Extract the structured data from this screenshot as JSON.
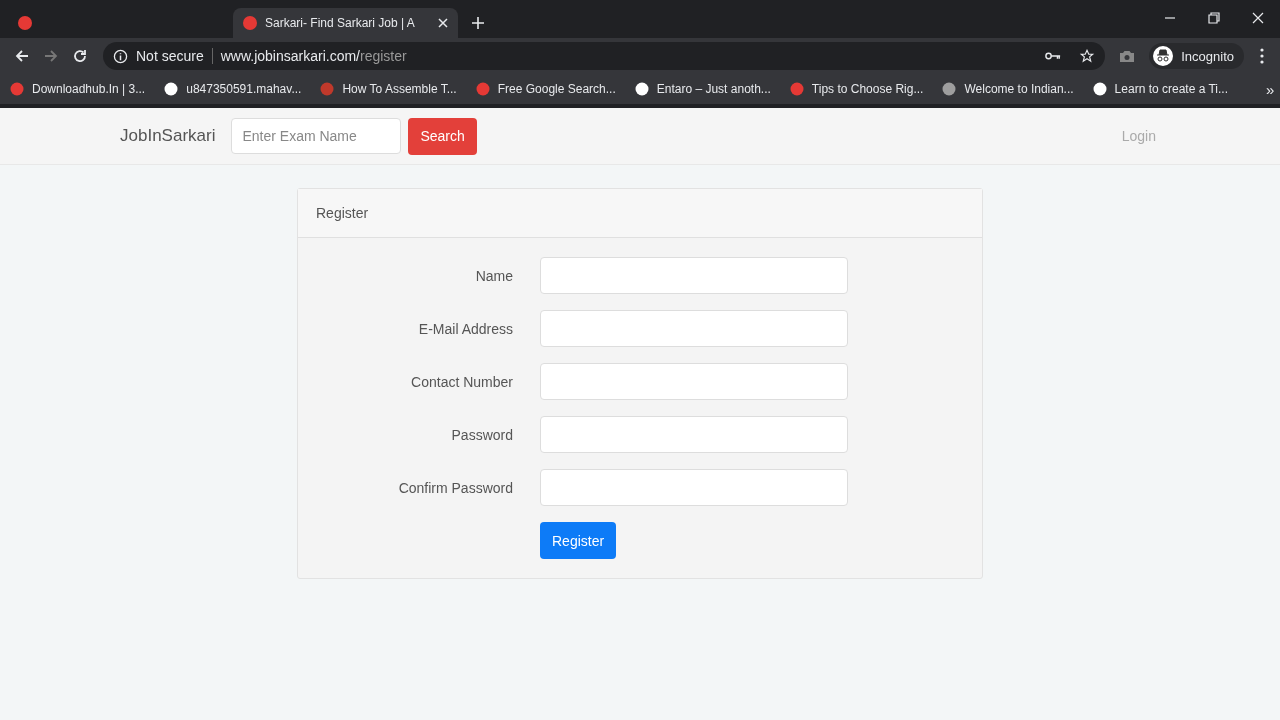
{
  "tabs": [
    {
      "selected": false
    },
    {
      "title": "Sarkari- Find Sarkari Job | A",
      "selected": true
    }
  ],
  "address_bar": {
    "security": "Not secure",
    "url_host": "www.jobinsarkari.com/",
    "url_path": "register"
  },
  "profile": {
    "label": "Incognito"
  },
  "bookmarks": [
    "Downloadhub.In | 3...",
    "u847350591.mahav...",
    "How To Assemble T...",
    "Free Google Search...",
    "Entaro – Just anoth...",
    "Tips to Choose Rig...",
    "Welcome to Indian...",
    "Learn to create a Ti..."
  ],
  "bookmarks_more": "»",
  "navbar": {
    "brand": "JobInSarkari",
    "search_placeholder": "Enter Exam Name",
    "search_button": "Search",
    "login": "Login"
  },
  "form": {
    "title": "Register",
    "fields": [
      {
        "label": "Name"
      },
      {
        "label": "E-Mail Address"
      },
      {
        "label": "Contact Number"
      },
      {
        "label": "Password"
      },
      {
        "label": "Confirm Password"
      }
    ],
    "submit": "Register"
  }
}
